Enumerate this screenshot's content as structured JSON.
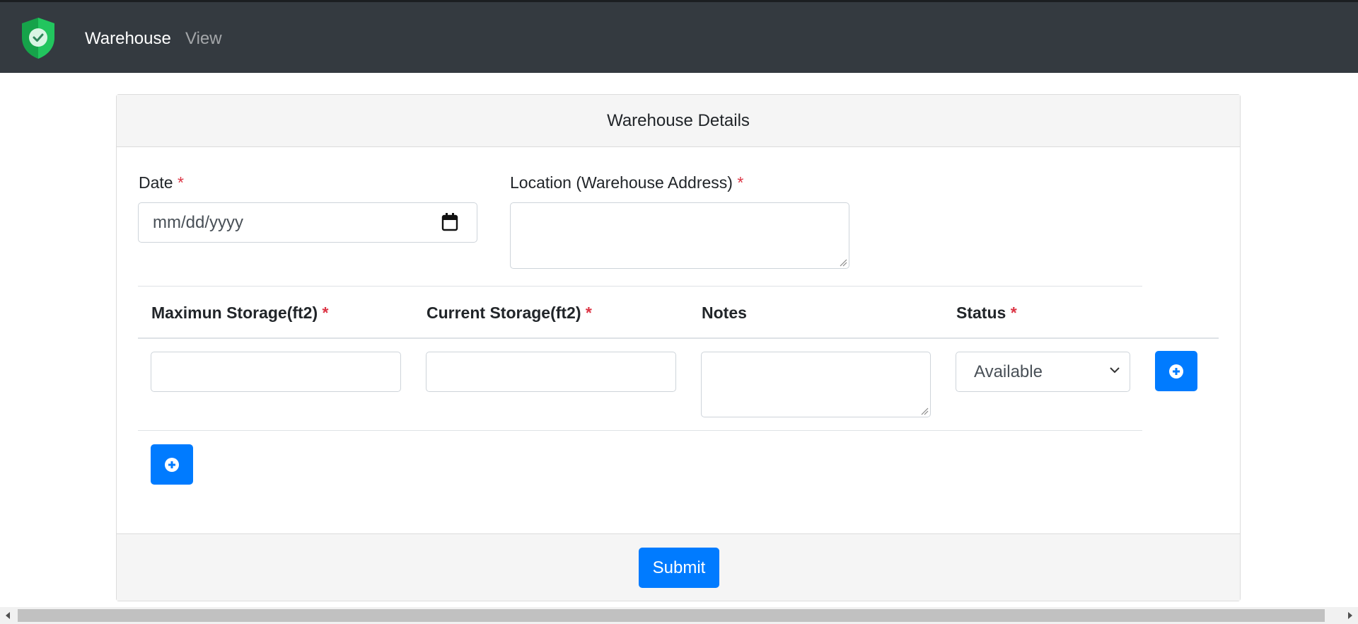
{
  "navbar": {
    "brand": "Warehouse",
    "links": [
      "View"
    ],
    "logo_icon": "shield-check-icon",
    "colors": {
      "background": "#343a40",
      "logo": "#22c55e"
    }
  },
  "card": {
    "header_title": "Warehouse Details",
    "fields": {
      "date": {
        "label": "Date",
        "required_mark": "*",
        "placeholder": "mm/dd/yyyy",
        "icon": "calendar-icon"
      },
      "location": {
        "label": "Location (Warehouse Address)",
        "required_mark": "*",
        "value": ""
      }
    },
    "table": {
      "headers": [
        {
          "label": "Maximun Storage(ft2)",
          "required_mark": "*"
        },
        {
          "label": "Current Storage(ft2)",
          "required_mark": "*"
        },
        {
          "label": "Notes",
          "required_mark": ""
        },
        {
          "label": "Status",
          "required_mark": "*"
        }
      ],
      "row": {
        "max_storage": "",
        "current_storage": "",
        "notes": "",
        "status_selected": "Available"
      }
    },
    "submit_label": "Submit"
  },
  "colors": {
    "primary": "#007bff",
    "required": "#dc3545"
  }
}
